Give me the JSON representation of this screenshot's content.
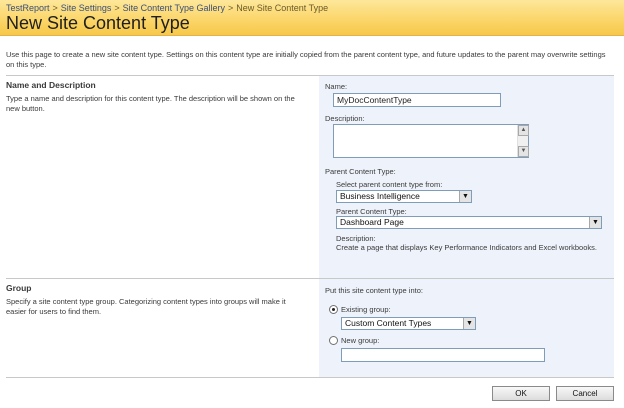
{
  "breadcrumb": {
    "items": [
      "TestReport",
      "Site Settings",
      "Site Content Type Gallery"
    ],
    "current": "New Site Content Type",
    "separator": ">"
  },
  "page_title": "New Site Content Type",
  "intro": "Use this page to create a new site content type. Settings on this content type are initially copied from the parent content type, and future updates to the parent may overwrite settings on this type.",
  "name_section": {
    "title": "Name and Description",
    "description": "Type a name and description for this content type. The description will be shown on the new button.",
    "name_label": "Name:",
    "name_value": "MyDocContentType",
    "description_label": "Description:",
    "description_value": "",
    "parent_label": "Parent Content Type:",
    "select_from_label": "Select parent content type from:",
    "select_from_value": "Business Intelligence",
    "parent_type_label": "Parent Content Type:",
    "parent_type_value": "Dashboard Page",
    "parent_desc_label": "Description:",
    "parent_desc_text": "Create a page that displays Key Performance Indicators and Excel workbooks."
  },
  "group_section": {
    "title": "Group",
    "description": "Specify a site content type group. Categorizing content types into groups will make it easier for users to find them.",
    "put_label": "Put this site content type into:",
    "existing_label": "Existing group:",
    "existing_value": "Custom Content Types",
    "new_label": "New group:",
    "new_value": ""
  },
  "buttons": {
    "ok": "OK",
    "cancel": "Cancel"
  },
  "icons": {
    "dropdown": "chevron-down-icon",
    "scroll_up": "scroll-up-icon",
    "scroll_down": "scroll-down-icon"
  },
  "colors": {
    "header": "#fbd66a",
    "panel": "#eef3fb",
    "link": "#3b4f7a"
  }
}
